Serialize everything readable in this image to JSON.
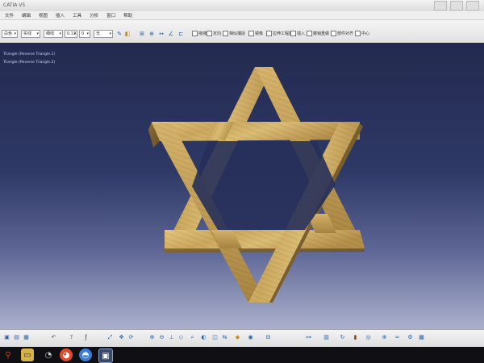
{
  "window": {
    "title": "CATIA V5",
    "title_icons": [
      "minimize-icon",
      "maximize-icon",
      "close-icon"
    ]
  },
  "menu": {
    "items": [
      "文件",
      "编辑",
      "视图",
      "插入",
      "工具",
      "分析",
      "窗口",
      "帮助"
    ]
  },
  "toolbar": {
    "selects": [
      {
        "value": "白色"
      },
      {
        "value": "实线"
      },
      {
        "value": "细线"
      },
      {
        "value": "0.13"
      },
      {
        "value": "0"
      },
      {
        "value": "无"
      }
    ],
    "checkboxes": [
      "拖拽",
      "定向",
      "相似捕捉",
      "镜像",
      "拉伸工程图",
      "插入",
      "撤销重做",
      "部件对齐",
      "中心"
    ]
  },
  "tree": {
    "lines": [
      "Triangle (Reverse Triangle.1)",
      "Triangle (Reverse Triangle.2)"
    ]
  },
  "colors": {
    "wood_light": "#d8b870",
    "wood_mid": "#b8944f",
    "wood_dark": "#7f6431",
    "bg_top": "#232a4f",
    "bg_bottom": "#aab0cc"
  }
}
